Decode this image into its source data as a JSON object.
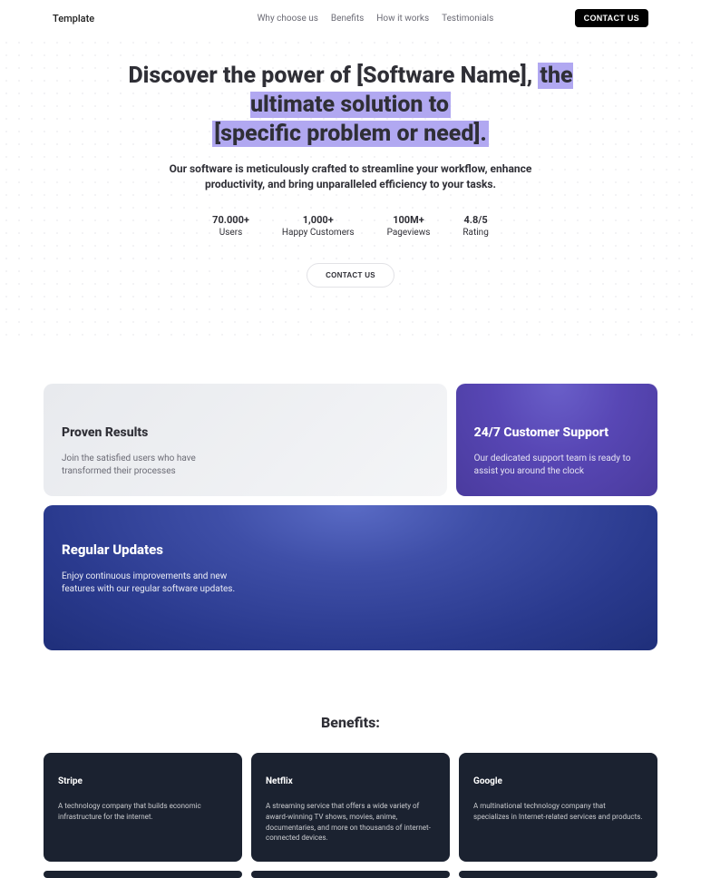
{
  "header": {
    "logo": "Template",
    "nav": [
      "Why choose us",
      "Benefits",
      "How it works",
      "Testimonials"
    ],
    "contact_label": "CONTACT US"
  },
  "hero": {
    "title_plain": "Discover the power of [Software Name],",
    "title_hl1": "the ultimate solution to",
    "title_hl2": "[specific problem or need].",
    "sub": "Our software is meticulously crafted to streamline your workflow, enhance productivity, and bring unparalleled efficiency to your tasks.",
    "stats": [
      {
        "value": "70.000+",
        "label": "Users"
      },
      {
        "value": "1,000+",
        "label": "Happy Customers"
      },
      {
        "value": "100M+",
        "label": "Pageviews"
      },
      {
        "value": "4.8/5",
        "label": "Rating"
      }
    ],
    "cta_label": "CONTACT US"
  },
  "features": [
    {
      "title": "Proven Results",
      "desc": "Join the satisfied users who have transformed their processes"
    },
    {
      "title": "24/7 Customer Support",
      "desc": "Our dedicated support team is ready to assist you around the clock"
    },
    {
      "title": "Regular Updates",
      "desc": "Enjoy continuous improvements and new features with our regular software updates."
    }
  ],
  "benefits": {
    "title": "Benefits:",
    "items": [
      {
        "name": "Stripe",
        "desc": "A technology company that builds economic infrastructure for the internet."
      },
      {
        "name": "Netflix",
        "desc": "A streaming service that offers a wide variety of award-winning TV shows, movies, anime, documentaries, and more on thousands of internet-connected devices."
      },
      {
        "name": "Google",
        "desc": "A multinational technology company that specializes in Internet-related services and products."
      }
    ]
  }
}
